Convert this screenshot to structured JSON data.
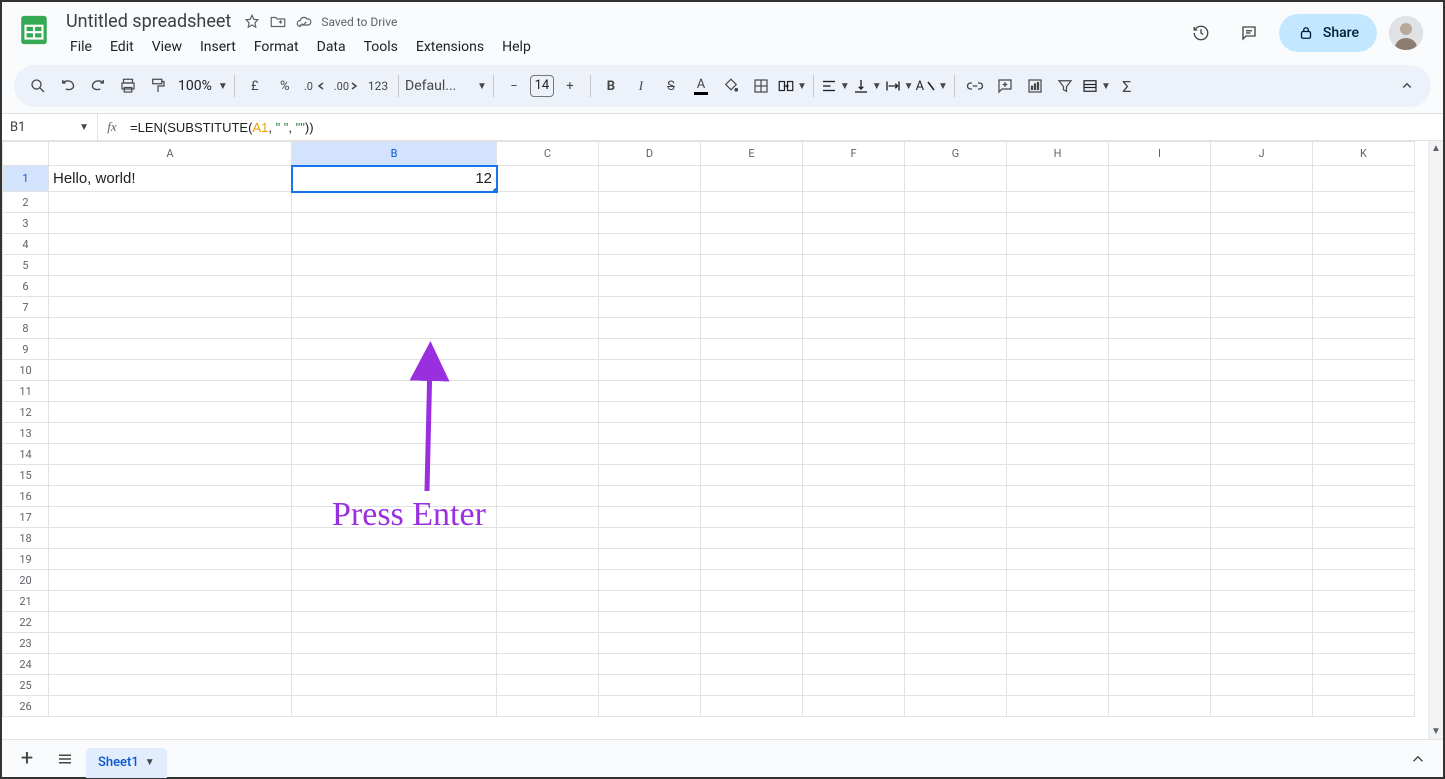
{
  "header": {
    "title": "Untitled spreadsheet",
    "saved": "Saved to Drive",
    "menus": [
      "File",
      "Edit",
      "View",
      "Insert",
      "Format",
      "Data",
      "Tools",
      "Extensions",
      "Help"
    ],
    "share": "Share"
  },
  "toolbar": {
    "zoom": "100%",
    "currency": "£",
    "percent": "%",
    "dec_dec": ".0",
    "inc_dec": ".00",
    "num123": "123",
    "font": "Defaul...",
    "fsize": "14"
  },
  "fx": {
    "namebox": "B1",
    "prefix": "=LEN(SUBSTITUTE(",
    "ref": "A1",
    "mid": ", ",
    "s1": "\" \"",
    "mid2": ", ",
    "s2": "\"\"",
    "suffix": "))"
  },
  "columns": [
    "A",
    "B",
    "C",
    "D",
    "E",
    "F",
    "G",
    "H",
    "I",
    "J",
    "K"
  ],
  "rows": 26,
  "cells": {
    "A1": "Hello, world!",
    "B1": "12"
  },
  "active": {
    "col": "B",
    "row": 1
  },
  "sheet": "Sheet1",
  "annotation": "Press Enter"
}
